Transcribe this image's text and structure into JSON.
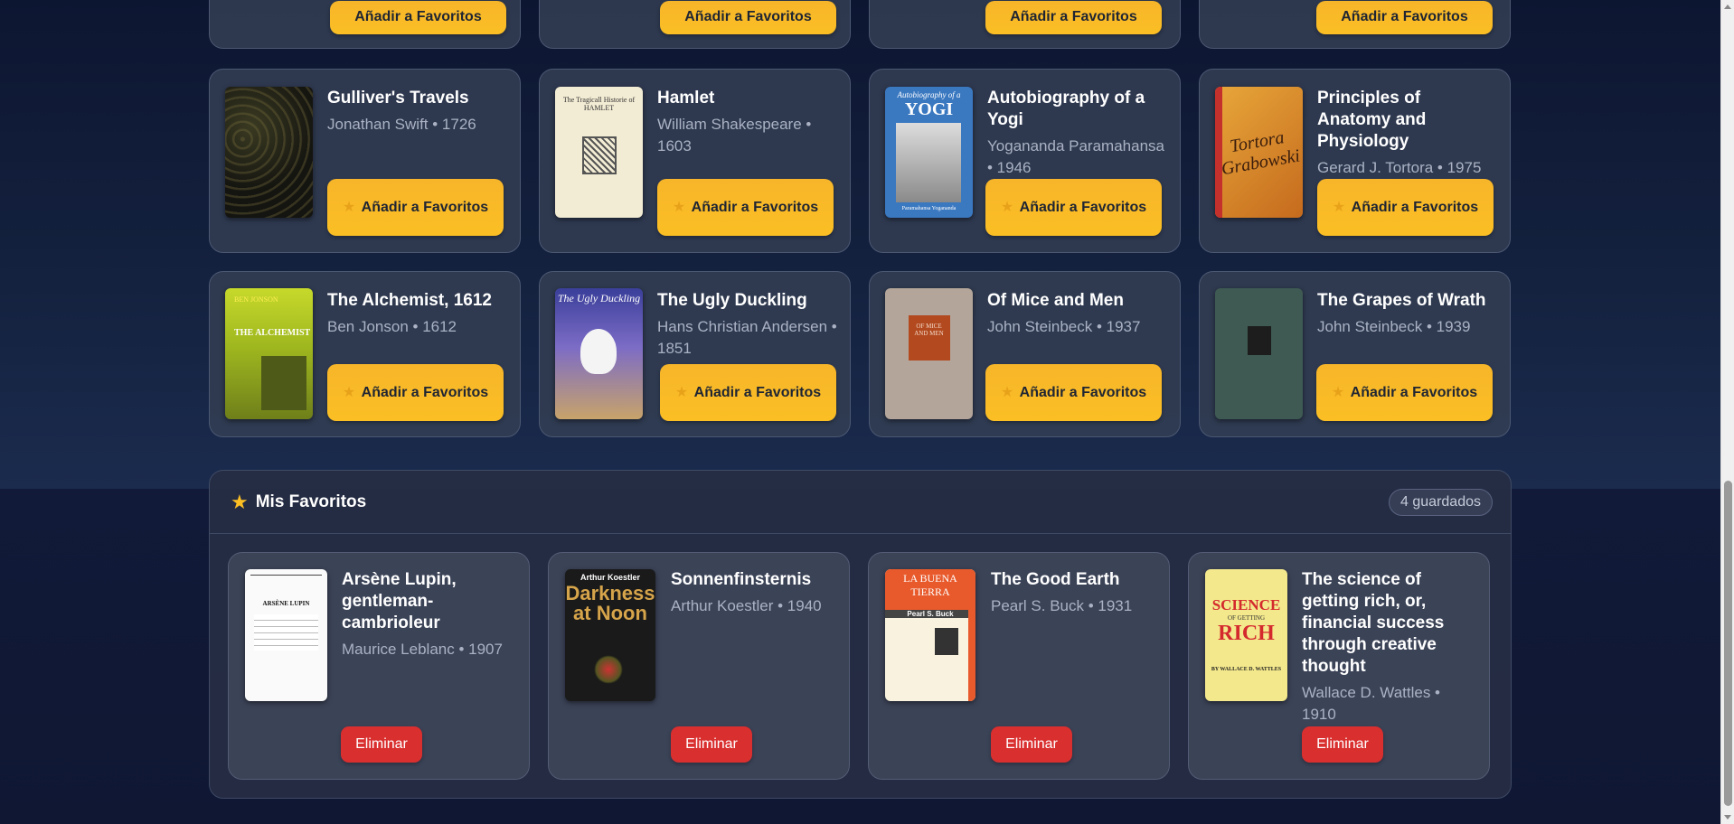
{
  "book_grid": {
    "row1_buttons": [
      "Añadir a Favoritos",
      "Añadir a Favoritos",
      "Añadir a Favoritos",
      "Añadir a Favoritos"
    ],
    "books": [
      {
        "title": "Gulliver's Travels",
        "meta": "Jonathan Swift • 1726",
        "button": "Añadir a Favoritos",
        "cover": "gulliver"
      },
      {
        "title": "Hamlet",
        "meta": "William Shakespeare • 1603",
        "button": "Añadir a Favoritos",
        "cover": "hamlet"
      },
      {
        "title": "Autobiography of a Yogi",
        "meta": "Yogananda Paramahansa • 1946",
        "button": "Añadir a Favoritos",
        "cover": "yogi"
      },
      {
        "title": "Principles of Anatomy and Physiology",
        "meta": "Gerard J. Tortora • 1975",
        "button": "Añadir a Favoritos",
        "cover": "tortora"
      },
      {
        "title": "The Alchemist, 1612",
        "meta": "Ben Jonson • 1612",
        "button": "Añadir a Favoritos",
        "cover": "alchemist"
      },
      {
        "title": "The Ugly Duckling",
        "meta": "Hans Christian Andersen • 1851",
        "button": "Añadir a Favoritos",
        "cover": "duckling"
      },
      {
        "title": "Of Mice and Men",
        "meta": "John Steinbeck • 1937",
        "button": "Añadir a Favoritos",
        "cover": "mice"
      },
      {
        "title": "The Grapes of Wrath",
        "meta": "John Steinbeck • 1939",
        "button": "Añadir a Favoritos",
        "cover": "grapes"
      }
    ]
  },
  "favorites": {
    "title": "Mis Favoritos",
    "count_label": "4 guardados",
    "remove_label": "Eliminar",
    "items": [
      {
        "title": "Arsène Lupin, gentleman-cambrioleur",
        "meta": "Maurice Leblanc • 1907",
        "cover": "lupin"
      },
      {
        "title": "Sonnenfinsternis",
        "meta": "Arthur Koestler • 1940",
        "cover": "darkness"
      },
      {
        "title": "The Good Earth",
        "meta": "Pearl S. Buck • 1931",
        "cover": "earth"
      },
      {
        "title": "The science of getting rich, or, financial success through creative thought",
        "meta": "Wallace D. Wattles • 1910",
        "cover": "science"
      }
    ]
  },
  "cover_text": {
    "hamlet": "The Tragicall Historie of HAMLET",
    "yogi_top": "Autobiography of a",
    "yogi_big": "YOGI",
    "yogi_author": "Paramahansa Yogananda",
    "tortora": "Tortora Grabowski",
    "alchemist_author": "BEN JONSON",
    "alchemist_title": "THE ALCHEMIST",
    "duckling": "The Ugly Duckling",
    "mice": "OF MICE AND MEN",
    "lupin": "ARSÈNE LUPIN",
    "darkness_author": "Arthur Koestler",
    "darkness_title": "Darkness at Noon",
    "earth_title": "LA BUENA TIERRA",
    "earth_author": "Pearl S. Buck",
    "science_big": "SCIENCE",
    "science_sub": "OF GETTING",
    "science_rich": "RICH",
    "science_author": "BY WALLACE D. WATTLES"
  },
  "colors": {
    "accent_button": "#fbbf24",
    "remove_button": "#d92f2f",
    "card_bg": "#343e54"
  },
  "icons": {
    "fav_button": "star-icon",
    "panel_header": "star-icon"
  }
}
